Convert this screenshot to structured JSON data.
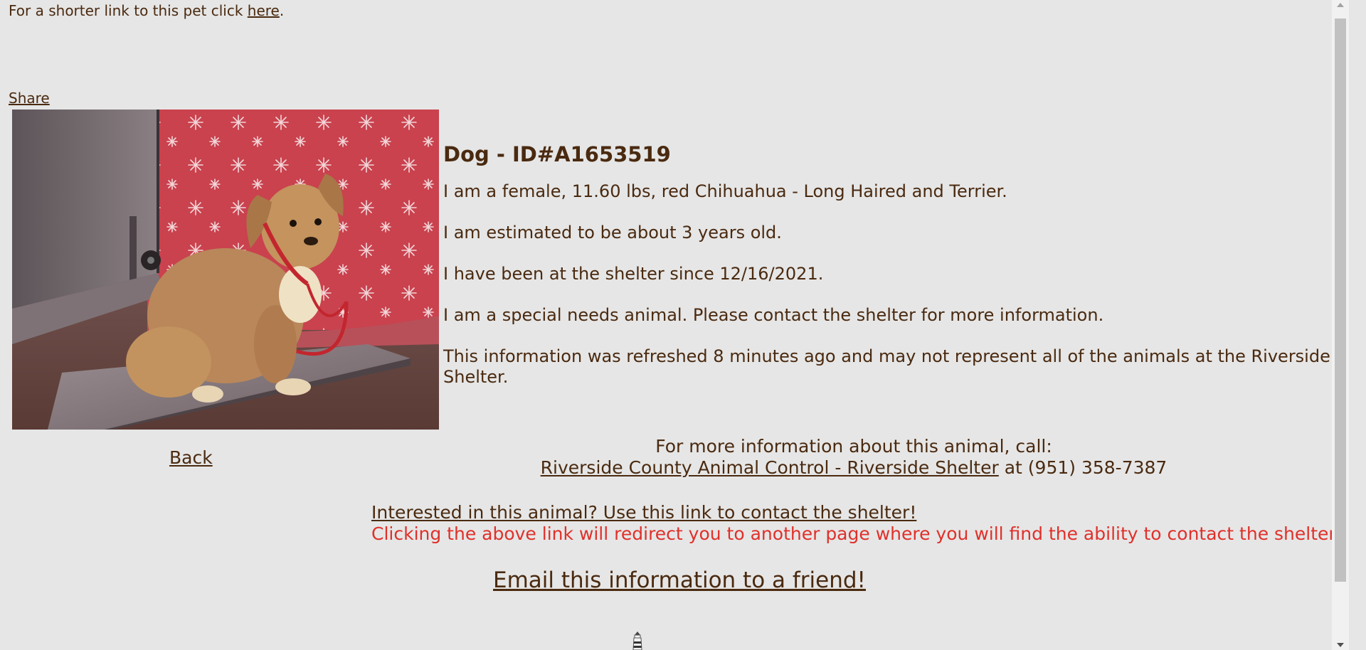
{
  "header": {
    "shortlink_prefix": "For a shorter link to this pet click",
    "shortlink_link": "here",
    "shortlink_suffix": ".",
    "share_label": "Share"
  },
  "pet": {
    "title": "Dog - ID#A1653519",
    "description": "I am a female, 11.60 lbs, red Chihuahua - Long Haired and Terrier.",
    "age": "I am estimated to be about 3 years old.",
    "shelter_since": "I have been at the shelter since 12/16/2021.",
    "special_needs": "I am a special needs animal. Please contact the shelter for more information.",
    "refresh_note": "This information was refreshed 8 minutes ago and may not represent all of the animals at the Riverside Shelter.",
    "photo_icon": "dog-photo"
  },
  "navigation": {
    "back_label": "Back"
  },
  "contact": {
    "more_info_label": "For more information about this animal, call:",
    "shelter_link": "Riverside County Animal Control - Riverside Shelter",
    "phone_text": "at (951) 358-7387",
    "interested_link": "Interested in this animal? Use this link to contact the shelter!",
    "redirect_note": "Clicking the above link will redirect you to another page where you will find the ability to contact the shelter.",
    "email_link": "Email this information to a friend!"
  },
  "colors": {
    "background": "#e6e6e6",
    "text": "#4a2a10",
    "warning": "#e0302a"
  }
}
